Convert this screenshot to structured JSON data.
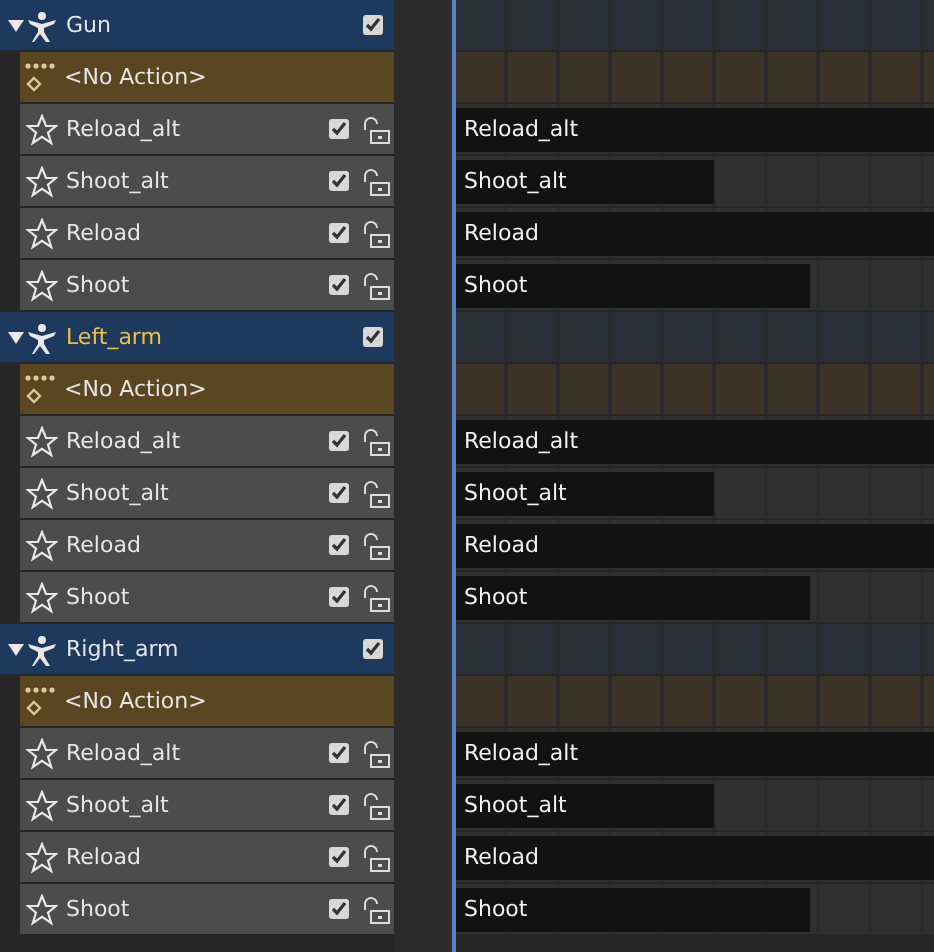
{
  "objects": [
    {
      "name": "Gun",
      "expanded": true,
      "active": false,
      "checked": true,
      "action": "<No Action>",
      "tracks": [
        {
          "name": "Reload_alt",
          "checked": true,
          "locked": false,
          "strip": "Reload_alt",
          "level": 1
        },
        {
          "name": "Shoot_alt",
          "checked": true,
          "locked": false,
          "strip": "Shoot_alt",
          "level": 0.54
        },
        {
          "name": "Reload",
          "checked": true,
          "locked": false,
          "strip": "Reload",
          "level": 1
        },
        {
          "name": "Shoot",
          "checked": true,
          "locked": false,
          "strip": "Shoot",
          "level": 0.74
        }
      ]
    },
    {
      "name": "Left_arm",
      "expanded": true,
      "active": true,
      "checked": true,
      "action": "<No Action>",
      "tracks": [
        {
          "name": "Reload_alt",
          "checked": true,
          "locked": false,
          "strip": "Reload_alt",
          "level": 1
        },
        {
          "name": "Shoot_alt",
          "checked": true,
          "locked": false,
          "strip": "Shoot_alt",
          "level": 0.54
        },
        {
          "name": "Reload",
          "checked": true,
          "locked": false,
          "strip": "Reload",
          "level": 1
        },
        {
          "name": "Shoot",
          "checked": true,
          "locked": false,
          "strip": "Shoot",
          "level": 0.74
        }
      ]
    },
    {
      "name": "Right_arm",
      "expanded": true,
      "active": false,
      "checked": true,
      "action": "<No Action>",
      "tracks": [
        {
          "name": "Reload_alt",
          "checked": true,
          "locked": false,
          "strip": "Reload_alt",
          "level": 1
        },
        {
          "name": "Shoot_alt",
          "checked": true,
          "locked": false,
          "strip": "Shoot_alt",
          "level": 0.54
        },
        {
          "name": "Reload",
          "checked": true,
          "locked": false,
          "strip": "Reload",
          "level": 1
        },
        {
          "name": "Shoot",
          "checked": true,
          "locked": false,
          "strip": "Shoot",
          "level": 0.74
        }
      ]
    }
  ]
}
